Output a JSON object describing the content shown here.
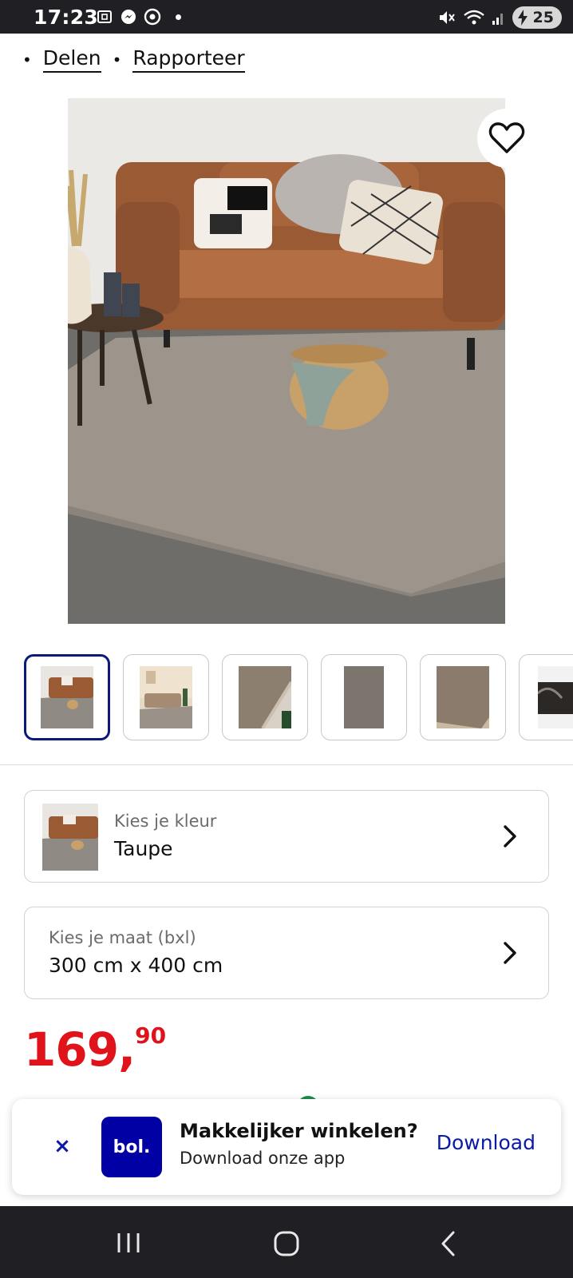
{
  "status_bar": {
    "time": "17:23",
    "left_icons": [
      "screenshot-icon",
      "messenger-icon",
      "chrome-icon"
    ],
    "right_icons": [
      "mute-icon",
      "wifi-icon",
      "signal-icon"
    ],
    "battery": "25"
  },
  "top_links": [
    {
      "label": "Delen"
    },
    {
      "label": "Rapporteer"
    }
  ],
  "hero": {
    "icon": "heart-icon"
  },
  "thumbnails": [
    {
      "icon": "thumb-living-room",
      "selected": true
    },
    {
      "icon": "thumb-room-wide",
      "selected": false
    },
    {
      "icon": "thumb-rug-closeup",
      "selected": false
    },
    {
      "icon": "thumb-rug-flat",
      "selected": false
    },
    {
      "icon": "thumb-rug-texture",
      "selected": false
    },
    {
      "icon": "thumb-rug-edge",
      "selected": false
    }
  ],
  "color_option": {
    "label": "Kies je kleur",
    "value": "Taupe"
  },
  "size_option": {
    "label": "Kies je maat (bxl)",
    "value": "300 cm x 400 cm"
  },
  "price": {
    "whole": "169,",
    "cents": "90"
  },
  "app_banner": {
    "close": "×",
    "logo": "bol.",
    "title": "Makkelijker winkelen?",
    "subtitle": "Download onze app",
    "action": "Download"
  },
  "nav_bar": {
    "icons": [
      "recent-apps-icon",
      "home-icon",
      "back-icon"
    ]
  },
  "colors": {
    "price_red": "#e0121a",
    "brand_blue": "#0000a4",
    "link_blue": "#0b1aa6"
  }
}
